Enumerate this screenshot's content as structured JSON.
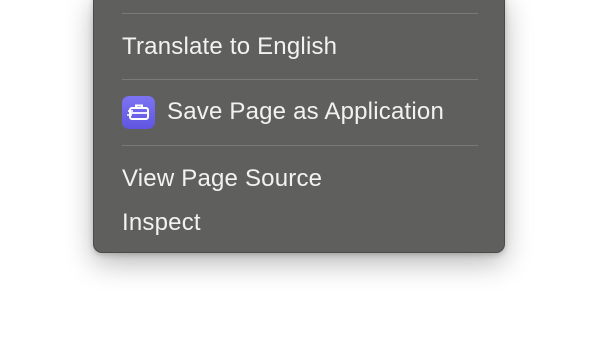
{
  "menu": {
    "items": [
      {
        "label": "Translate to English"
      },
      {
        "label": "Save Page as Application",
        "icon": "app-briefcase-icon",
        "icon_color": "#6a63ea"
      },
      {
        "label": "View Page Source"
      },
      {
        "label": "Inspect"
      }
    ],
    "colors": {
      "background": "#5f605e",
      "text": "#f2f2f2",
      "separator": "#7a7b79"
    }
  }
}
